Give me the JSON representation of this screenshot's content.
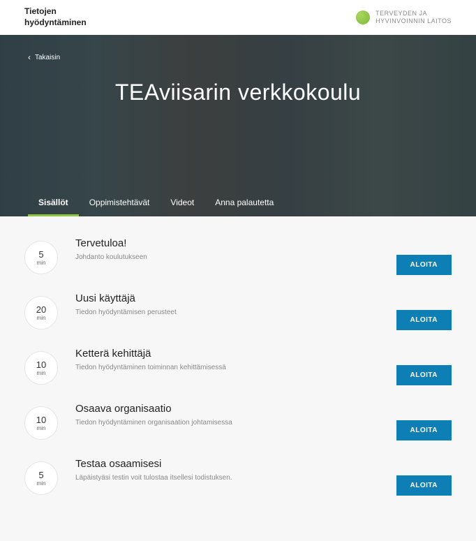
{
  "header": {
    "left_label_top": "Tietojen",
    "left_label_bottom": "hyödyntäminen",
    "org_line1": "TERVEYDEN JA",
    "org_line2": "HYVINVOINNIN LAITOS"
  },
  "hero": {
    "back_label": "Takaisin",
    "title": "TEAviisarin verkkokoulu"
  },
  "tabs": [
    {
      "label": "Sisällöt",
      "active": true
    },
    {
      "label": "Oppimistehtävät",
      "active": false
    },
    {
      "label": "Videot",
      "active": false
    },
    {
      "label": "Anna palautetta",
      "active": false
    }
  ],
  "courses": [
    {
      "time": "5",
      "unit": "min",
      "title": "Tervetuloa!",
      "desc": "Johdanto koulutukseen",
      "cta": "ALOITA"
    },
    {
      "time": "20",
      "unit": "min",
      "title": "Uusi käyttäjä",
      "desc": "Tiedon hyödyntämisen perusteet",
      "cta": "ALOITA"
    },
    {
      "time": "10",
      "unit": "min",
      "title": "Ketterä kehittäjä",
      "desc": "Tiedon hyödyntäminen toiminnan kehittämisessä",
      "cta": "ALOITA"
    },
    {
      "time": "10",
      "unit": "min",
      "title": "Osaava organisaatio",
      "desc": "Tiedon hyödyntäminen organisaation johtamisessa",
      "cta": "ALOITA"
    },
    {
      "time": "5",
      "unit": "min",
      "title": "Testaa osaamisesi",
      "desc": "Läpäistyäsi testin voit tulostaa itsellesi todistuksen.",
      "cta": "ALOITA"
    }
  ]
}
